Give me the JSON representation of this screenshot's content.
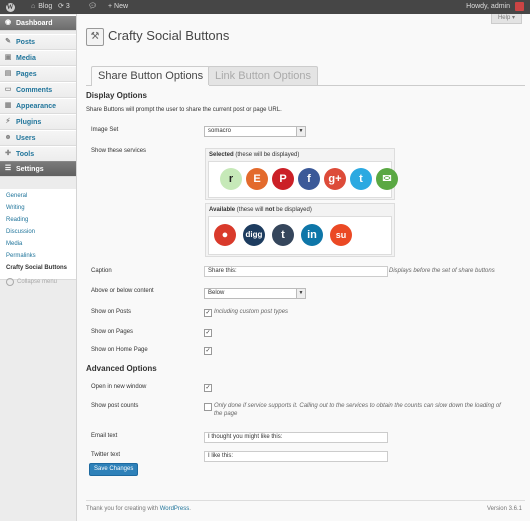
{
  "admin_bar": {
    "site": "Blog",
    "updates": "3",
    "new_label": "+ New",
    "howdy": "Howdy, admin"
  },
  "sidebar": {
    "items": [
      {
        "label": "Dashboard",
        "icon": "dashboard-icon"
      },
      {
        "label": "Posts",
        "icon": "pin-icon"
      },
      {
        "label": "Media",
        "icon": "media-icon"
      },
      {
        "label": "Pages",
        "icon": "page-icon"
      },
      {
        "label": "Comments",
        "icon": "comment-icon"
      },
      {
        "label": "Appearance",
        "icon": "brush-icon"
      },
      {
        "label": "Plugins",
        "icon": "plug-icon"
      },
      {
        "label": "Users",
        "icon": "users-icon"
      },
      {
        "label": "Tools",
        "icon": "wrench-icon"
      },
      {
        "label": "Settings",
        "icon": "settings-icon"
      }
    ],
    "submenu": [
      "General",
      "Writing",
      "Reading",
      "Discussion",
      "Media",
      "Permalinks",
      "Crafty Social Buttons"
    ],
    "collapse": "Collapse menu"
  },
  "help": "Help ▾",
  "page_title": "Crafty Social Buttons",
  "tabs": [
    "Share Button Options",
    "Link Button Options"
  ],
  "display": {
    "title": "Display Options",
    "description": "Share Buttons will prompt the user to share the current post or page URL.",
    "image_set_label": "Image Set",
    "image_set_value": "somacro",
    "services_label": "Show these services",
    "selected_title_a": "Selected",
    "selected_title_b": " (these will be displayed)",
    "available_title_a": "Available",
    "available_title_b": " (these will ",
    "available_title_not": "not",
    "available_title_c": " be displayed)",
    "caption_label": "Caption",
    "caption_value": "Share this:",
    "caption_hint": "Displays before the set of share buttons",
    "position_label": "Above or below content",
    "position_value": "Below",
    "show_posts_label": "Show on Posts",
    "show_posts_hint": "Including custom post types",
    "show_pages_label": "Show on Pages",
    "show_home_label": "Show on Home Page"
  },
  "selected_services": [
    {
      "name": "reddit-r",
      "glyph": "r",
      "bg": "#c6e9b8",
      "fg": "#222"
    },
    {
      "name": "etsy",
      "glyph": "E",
      "bg": "#e36a2c",
      "fg": "#fff"
    },
    {
      "name": "pinterest",
      "glyph": "P",
      "bg": "#cb2027",
      "fg": "#fff"
    },
    {
      "name": "facebook",
      "glyph": "f",
      "bg": "#3b5998",
      "fg": "#fff"
    },
    {
      "name": "google-plus",
      "glyph": "g+",
      "bg": "#dd4b39",
      "fg": "#fff"
    },
    {
      "name": "twitter",
      "glyph": "t",
      "bg": "#2ba9e1",
      "fg": "#fff"
    },
    {
      "name": "email",
      "glyph": "✉",
      "bg": "#5aa843",
      "fg": "#fff"
    }
  ],
  "available_services": [
    {
      "name": "reddit",
      "glyph": "●",
      "bg": "#d93a2b",
      "fg": "#fff"
    },
    {
      "name": "digg",
      "glyph": "digg",
      "bg": "#1d3c5f",
      "fg": "#fff"
    },
    {
      "name": "tumblr",
      "glyph": "t",
      "bg": "#35465c",
      "fg": "#fff"
    },
    {
      "name": "linkedin",
      "glyph": "in",
      "bg": "#0e76a8",
      "fg": "#fff"
    },
    {
      "name": "stumbleupon",
      "glyph": "su",
      "bg": "#eb4924",
      "fg": "#fff"
    }
  ],
  "advanced": {
    "title": "Advanced Options",
    "new_window_label": "Open in new window",
    "post_counts_label": "Show post counts",
    "post_counts_hint_1": "Only done if service supports it. Calling out to the services to obtain the counts can slow down the loading of",
    "post_counts_hint_2": "the page",
    "email_label": "Email text",
    "email_value": "I thought you might like this:",
    "twitter_label": "Twitter text",
    "twitter_value": "I like this:"
  },
  "save_button": "Save Changes",
  "footer": {
    "thanks": "Thank you for creating with ",
    "link": "WordPress",
    "period": ".",
    "version": "Version 3.6.1"
  }
}
